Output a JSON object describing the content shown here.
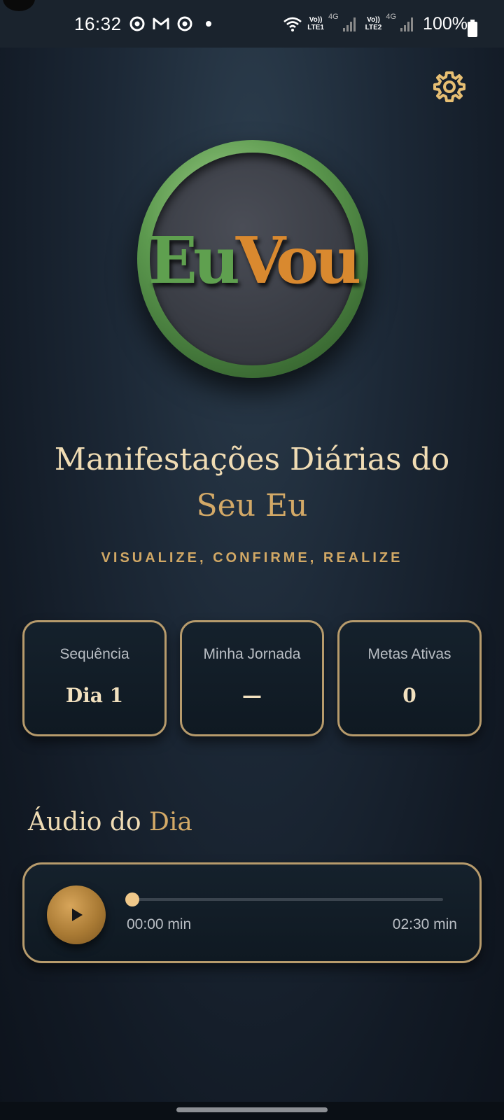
{
  "status_bar": {
    "time": "16:32",
    "sim1_top": "Vo))",
    "sim1_bottom": "LTE1",
    "sim2_top": "Vo))",
    "sim2_bottom": "LTE2",
    "network_type": "4G",
    "battery": "100%"
  },
  "header": {
    "settings_icon": "gear-icon"
  },
  "logo": {
    "part1": "Eu",
    "part2": "Vou"
  },
  "hero": {
    "title_line1": "Manifestações Diárias do",
    "title_line2": "Seu Eu",
    "subtitle": "VISUALIZE, CONFIRME, REALIZE"
  },
  "stats": [
    {
      "label": "Sequência",
      "value": "Dia 1"
    },
    {
      "label": "Minha Jornada",
      "value": "—"
    },
    {
      "label": "Metas Ativas",
      "value": "0"
    }
  ],
  "audio": {
    "section_title_part1": "Áudio do",
    "section_title_part2": "Dia",
    "current_time": "00:00 min",
    "duration": "02:30 min",
    "progress": 0
  },
  "colors": {
    "accent_gold": "#d3a967",
    "card_border": "#b79b6c",
    "logo_green": "#5fa04f",
    "logo_orange": "#d9892f"
  }
}
